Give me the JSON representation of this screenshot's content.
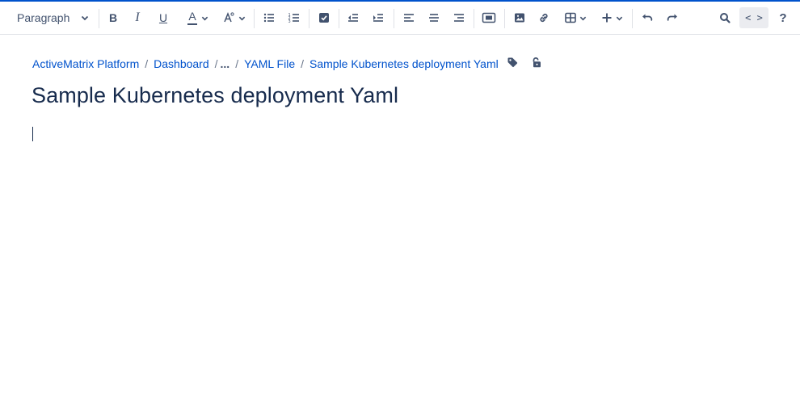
{
  "toolbar": {
    "paragraph_style": "Paragraph",
    "text_color_icon": "A",
    "code_label": "< >",
    "help_label": "?",
    "buttons": [
      {
        "name": "bold-icon",
        "label": "B"
      },
      {
        "name": "italic-icon",
        "label": "I"
      },
      {
        "name": "underline-icon",
        "label": "U"
      }
    ]
  },
  "breadcrumb": {
    "items": [
      "ActiveMatrix Platform",
      "Dashboard",
      "...",
      "YAML File",
      "Sample Kubernetes deployment Yaml"
    ],
    "separator": "/"
  },
  "page": {
    "title": "Sample Kubernetes deployment Yaml"
  },
  "colors": {
    "accent": "#0052cc",
    "text": "#172b4d",
    "icon": "#42526e"
  }
}
